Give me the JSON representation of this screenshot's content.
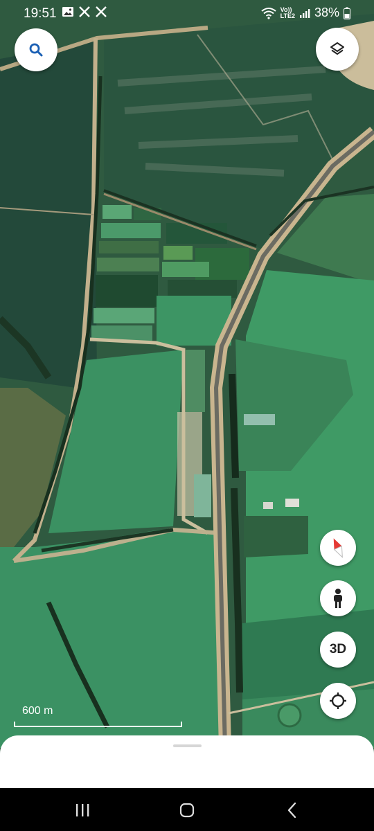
{
  "status_bar": {
    "time": "19:51",
    "left_icons": [
      "gallery-icon",
      "x-logo-icon",
      "x-logo-icon"
    ],
    "network_label_top": "Vo))",
    "network_label_bottom": "LTE2",
    "battery_percent": "38%"
  },
  "map_controls": {
    "search_icon": "search-icon",
    "layers_icon": "layers-icon",
    "compass_icon": "compass-icon",
    "street_view_icon": "person-icon",
    "three_d_label": "3D",
    "my_location_icon": "crosshair-icon"
  },
  "scale": {
    "label": "600 m"
  },
  "colors": {
    "search_accent": "#1a5fb4",
    "compass_red": "#e53935",
    "field_green": "#3f9a65",
    "dark_field": "#234a36"
  },
  "nav_bar": {
    "recent_icon": "recent-apps-icon",
    "home_icon": "home-icon",
    "back_icon": "back-icon"
  }
}
